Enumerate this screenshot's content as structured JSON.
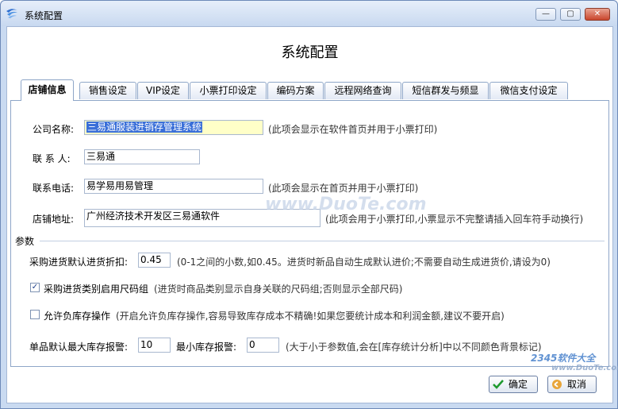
{
  "window": {
    "title": "系统配置",
    "controls": {
      "minimize": "—",
      "maximize": "▢",
      "close": "✕"
    }
  },
  "header": {
    "title": "系统配置"
  },
  "tabs": [
    {
      "label": "店铺信息",
      "active": true
    },
    {
      "label": "销售设定",
      "active": false
    },
    {
      "label": "VIP设定",
      "active": false
    },
    {
      "label": "小票打印设定",
      "active": false
    },
    {
      "label": "编码方案",
      "active": false
    },
    {
      "label": "远程网络查询",
      "active": false
    },
    {
      "label": "短信群发与频显",
      "active": false
    },
    {
      "label": "微信支付设定",
      "active": false
    }
  ],
  "shop": {
    "name_label": "公司名称:",
    "name_value": "三易通服装进销存管理系统",
    "name_note": "(此项会显示在软件首页并用于小票打印)",
    "contact_label": "联 系 人:",
    "contact_value": "三易通",
    "phone_label": "联系电话:",
    "phone_value": "易学易用易管理",
    "phone_note": "(此项会显示在首页并用于小票打印)",
    "address_label": "店铺地址:",
    "address_value": "广州经济技术开发区三易通软件",
    "address_note": "(此项会用于小票打印,小票显示不完整请插入回车符手动换行)"
  },
  "params": {
    "group_label": "参数",
    "discount_label": "采购进货默认进货折扣:",
    "discount_value": "0.45",
    "discount_note": "(0-1之间的小数,如0.45。进货时新品自动生成默认进价;不需要自动生成进货价,请设为0)",
    "size_group_label": "采购进货类别启用尺码组",
    "size_group_checked": true,
    "size_group_note": "(进货时商品类别显示自身关联的尺码组;否则显示全部尺码)",
    "negative_stock_label": "允许负库存操作",
    "negative_stock_checked": false,
    "negative_stock_note": "(开启允许负库存操作,容易导致库存成本不精确!如果您要统计成本和利润金额,建议不要开启)",
    "max_stock_label": "单品默认最大库存报警:",
    "max_stock_value": "10",
    "min_stock_label": "最小库存报警:",
    "min_stock_value": "0",
    "stock_note": "(大于小于参数值,会在[库存统计分析]中以不同颜色背景标记)"
  },
  "footer": {
    "ok_label": "确定",
    "cancel_label": "取消"
  },
  "watermarks": {
    "center": "www.DuoTe.com",
    "corner": "2345软件大全",
    "corner_url": "www.DuoTe.com"
  },
  "colors": {
    "accent": "#3a6fd8",
    "highlight": "#ffffc8",
    "close": "#c9452c"
  }
}
